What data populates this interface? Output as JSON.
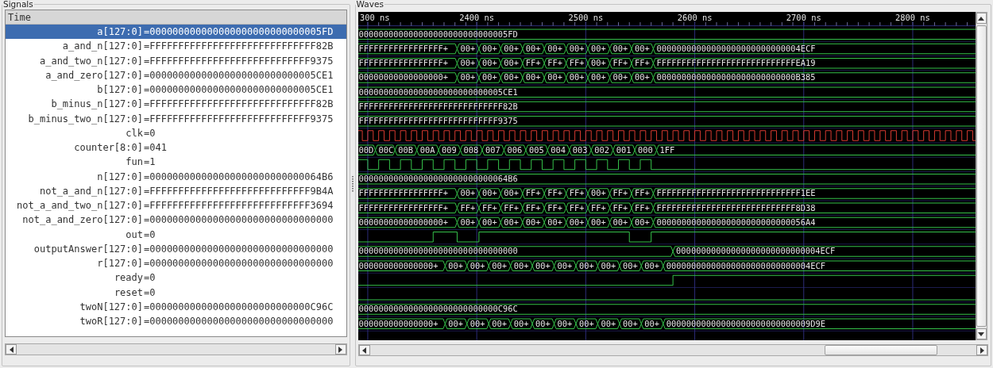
{
  "signals_panel": {
    "title": "Signals",
    "header": "Time",
    "signals": [
      {
        "name": "a[127:0]",
        "value": "=000000000000000000000000000005FD",
        "selected": true,
        "wave": {
          "kind": "bus",
          "segments": [
            {
              "value": "000000000000000000000000000005FD"
            }
          ]
        }
      },
      {
        "name": "a_and_n[127:0]",
        "value": "=FFFFFFFFFFFFFFFFFFFFFFFFFFFFF82B",
        "selected": false,
        "wave": {
          "kind": "bus",
          "segments": [
            {
              "value": "FFFFFFFFFFFFFFFFF+"
            },
            {
              "value": "00+"
            },
            {
              "value": "00+"
            },
            {
              "value": "00+"
            },
            {
              "value": "00+"
            },
            {
              "value": "00+"
            },
            {
              "value": "00+"
            },
            {
              "value": "00+"
            },
            {
              "value": "00+"
            },
            {
              "value": "00+"
            },
            {
              "value": "00000000000000000000000000004ECF"
            }
          ]
        }
      },
      {
        "name": "a_and_two_n[127:0]",
        "value": "=FFFFFFFFFFFFFFFFFFFFFFFFFFFF9375",
        "selected": false,
        "wave": {
          "kind": "bus",
          "segments": [
            {
              "value": "FFFFFFFFFFFFFFFFF+"
            },
            {
              "value": "00+"
            },
            {
              "value": "00+"
            },
            {
              "value": "00+"
            },
            {
              "value": "FF+"
            },
            {
              "value": "FF+"
            },
            {
              "value": "FF+"
            },
            {
              "value": "00+"
            },
            {
              "value": "FF+"
            },
            {
              "value": "FF+"
            },
            {
              "value": "FFFFFFFFFFFFFFFFFFFFFFFFFFFFEA19"
            }
          ]
        }
      },
      {
        "name": "a_and_zero[127:0]",
        "value": "=00000000000000000000000000005CE1",
        "selected": false,
        "wave": {
          "kind": "bus",
          "segments": [
            {
              "value": "00000000000000000+"
            },
            {
              "value": "00+"
            },
            {
              "value": "00+"
            },
            {
              "value": "00+"
            },
            {
              "value": "00+"
            },
            {
              "value": "00+"
            },
            {
              "value": "00+"
            },
            {
              "value": "00+"
            },
            {
              "value": "00+"
            },
            {
              "value": "00+"
            },
            {
              "value": "0000000000000000000000000000B385"
            }
          ]
        }
      },
      {
        "name": "b[127:0]",
        "value": "=00000000000000000000000000005CE1",
        "selected": false,
        "wave": {
          "kind": "bus",
          "segments": [
            {
              "value": "00000000000000000000000000005CE1"
            }
          ]
        }
      },
      {
        "name": "b_minus_n[127:0]",
        "value": "=FFFFFFFFFFFFFFFFFFFFFFFFFFFFF82B",
        "selected": false,
        "wave": {
          "kind": "bus",
          "segments": [
            {
              "value": "FFFFFFFFFFFFFFFFFFFFFFFFFFFFF82B"
            }
          ]
        }
      },
      {
        "name": "b_minus_two_n[127:0]",
        "value": "=FFFFFFFFFFFFFFFFFFFFFFFFFFFF9375",
        "selected": false,
        "wave": {
          "kind": "bus",
          "segments": [
            {
              "value": "FFFFFFFFFFFFFFFFFFFFFFFFFFFF9375"
            }
          ]
        }
      },
      {
        "name": "clk",
        "value": "=0",
        "selected": false,
        "wave": {
          "kind": "clock"
        }
      },
      {
        "name": "counter[8:0]",
        "value": "=041",
        "selected": false,
        "wave": {
          "kind": "bus",
          "segments": [
            {
              "value": "00D"
            },
            {
              "value": "00C"
            },
            {
              "value": "00B"
            },
            {
              "value": "00A"
            },
            {
              "value": "009"
            },
            {
              "value": "008"
            },
            {
              "value": "007"
            },
            {
              "value": "006"
            },
            {
              "value": "005"
            },
            {
              "value": "004"
            },
            {
              "value": "003"
            },
            {
              "value": "002"
            },
            {
              "value": "001"
            },
            {
              "value": "000"
            },
            {
              "value": "1FF"
            }
          ]
        }
      },
      {
        "name": "fun",
        "value": "=1",
        "selected": false,
        "wave": {
          "kind": "bit",
          "segments": [
            {
              "high": true
            },
            {
              "high": false
            },
            {
              "high": true
            },
            {
              "high": false
            },
            {
              "high": true
            },
            {
              "high": false
            },
            {
              "high": true
            },
            {
              "high": false
            },
            {
              "high": true
            },
            {
              "high": false
            },
            {
              "high": true
            },
            {
              "high": false
            },
            {
              "high": true
            },
            {
              "high": false
            },
            {
              "high": true
            },
            {
              "high": false
            },
            {
              "high": true
            },
            {
              "high": false
            },
            {
              "high": true
            },
            {
              "high": false
            },
            {
              "high": true
            },
            {
              "high": false
            },
            {
              "high": true
            },
            {
              "high": false
            },
            {
              "high": true
            },
            {
              "high": false
            },
            {
              "high": true
            },
            {
              "high": false
            }
          ]
        }
      },
      {
        "name": "n[127:0]",
        "value": "=000000000000000000000000000064B6",
        "selected": false,
        "wave": {
          "kind": "bus",
          "segments": [
            {
              "value": "000000000000000000000000000064B6"
            }
          ]
        }
      },
      {
        "name": "not_a_and_n[127:0]",
        "value": "=FFFFFFFFFFFFFFFFFFFFFFFFFFFF9B4A",
        "selected": false,
        "wave": {
          "kind": "bus",
          "segments": [
            {
              "value": "FFFFFFFFFFFFFFFFF+"
            },
            {
              "value": "00+"
            },
            {
              "value": "00+"
            },
            {
              "value": "00+"
            },
            {
              "value": "FF+"
            },
            {
              "value": "FF+"
            },
            {
              "value": "FF+"
            },
            {
              "value": "00+"
            },
            {
              "value": "FF+"
            },
            {
              "value": "FF+"
            },
            {
              "value": "FFFFFFFFFFFFFFFFFFFFFFFFFFFFF1EE"
            }
          ]
        }
      },
      {
        "name": "not_a_and_two_n[127:0]",
        "value": "=FFFFFFFFFFFFFFFFFFFFFFFFFFFF3694",
        "selected": false,
        "wave": {
          "kind": "bus",
          "segments": [
            {
              "value": "FFFFFFFFFFFFFFFFF+"
            },
            {
              "value": "FF+"
            },
            {
              "value": "FF+"
            },
            {
              "value": "FF+"
            },
            {
              "value": "FF+"
            },
            {
              "value": "FF+"
            },
            {
              "value": "FF+"
            },
            {
              "value": "FF+"
            },
            {
              "value": "FF+"
            },
            {
              "value": "FF+"
            },
            {
              "value": "FFFFFFFFFFFFFFFFFFFFFFFFFFFF8D38"
            }
          ]
        }
      },
      {
        "name": "not_a_and_zero[127:0]",
        "value": "=00000000000000000000000000000000",
        "selected": false,
        "wave": {
          "kind": "bus",
          "segments": [
            {
              "value": "00000000000000000+"
            },
            {
              "value": "00+"
            },
            {
              "value": "00+"
            },
            {
              "value": "00+"
            },
            {
              "value": "00+"
            },
            {
              "value": "00+"
            },
            {
              "value": "00+"
            },
            {
              "value": "00+"
            },
            {
              "value": "00+"
            },
            {
              "value": "00+"
            },
            {
              "value": "000000000000000000000000000056A4"
            }
          ]
        }
      },
      {
        "name": "out",
        "value": "=0",
        "selected": false,
        "wave": {
          "kind": "bit",
          "segments": [
            {
              "high": false
            },
            {
              "high": true
            },
            {
              "high": false
            },
            {
              "high": true
            },
            {
              "high": false
            },
            {
              "high": true
            }
          ]
        }
      },
      {
        "name": "outputAnswer[127:0]",
        "value": "=00000000000000000000000000000000",
        "selected": false,
        "wave": {
          "kind": "bus",
          "segments": [
            {
              "value": "00000000000000000000000000000000"
            },
            {
              "value": "00000000000000000000000000004ECF"
            }
          ]
        }
      },
      {
        "name": "r[127:0]",
        "value": "=00000000000000000000000000000000",
        "selected": false,
        "wave": {
          "kind": "bus",
          "segments": [
            {
              "value": "000000000000000+"
            },
            {
              "value": "00+"
            },
            {
              "value": "00+"
            },
            {
              "value": "00+"
            },
            {
              "value": "00+"
            },
            {
              "value": "00+"
            },
            {
              "value": "00+"
            },
            {
              "value": "00+"
            },
            {
              "value": "00+"
            },
            {
              "value": "00+"
            },
            {
              "value": "00+"
            },
            {
              "value": "00000000000000000000000000004ECF"
            }
          ]
        }
      },
      {
        "name": "ready",
        "value": "=0",
        "selected": false,
        "wave": {
          "kind": "bit",
          "segments": [
            {
              "high": false
            },
            {
              "high": true
            }
          ]
        }
      },
      {
        "name": "reset",
        "value": "=0",
        "selected": false,
        "wave": {
          "kind": "bit",
          "segments": [
            {
              "high": false
            }
          ]
        }
      },
      {
        "name": "twoN[127:0]",
        "value": "=0000000000000000000000000000C96C",
        "selected": false,
        "wave": {
          "kind": "bus",
          "segments": [
            {
              "value": "0000000000000000000000000000C96C"
            }
          ]
        }
      },
      {
        "name": "twoR[127:0]",
        "value": "=00000000000000000000000000000000",
        "selected": false,
        "wave": {
          "kind": "bus",
          "segments": [
            {
              "value": "000000000000000+"
            },
            {
              "value": "00+"
            },
            {
              "value": "00+"
            },
            {
              "value": "00+"
            },
            {
              "value": "00+"
            },
            {
              "value": "00+"
            },
            {
              "value": "00+"
            },
            {
              "value": "00+"
            },
            {
              "value": "00+"
            },
            {
              "value": "00+"
            },
            {
              "value": "00+"
            },
            {
              "value": "00000000000000000000000000009D9E"
            }
          ]
        }
      }
    ]
  },
  "waves_panel": {
    "title": "Waves",
    "ticks": [
      "300 ns",
      "2400 ns",
      "2500 ns",
      "2600 ns",
      "2700 ns",
      "2800 ns"
    ]
  }
}
